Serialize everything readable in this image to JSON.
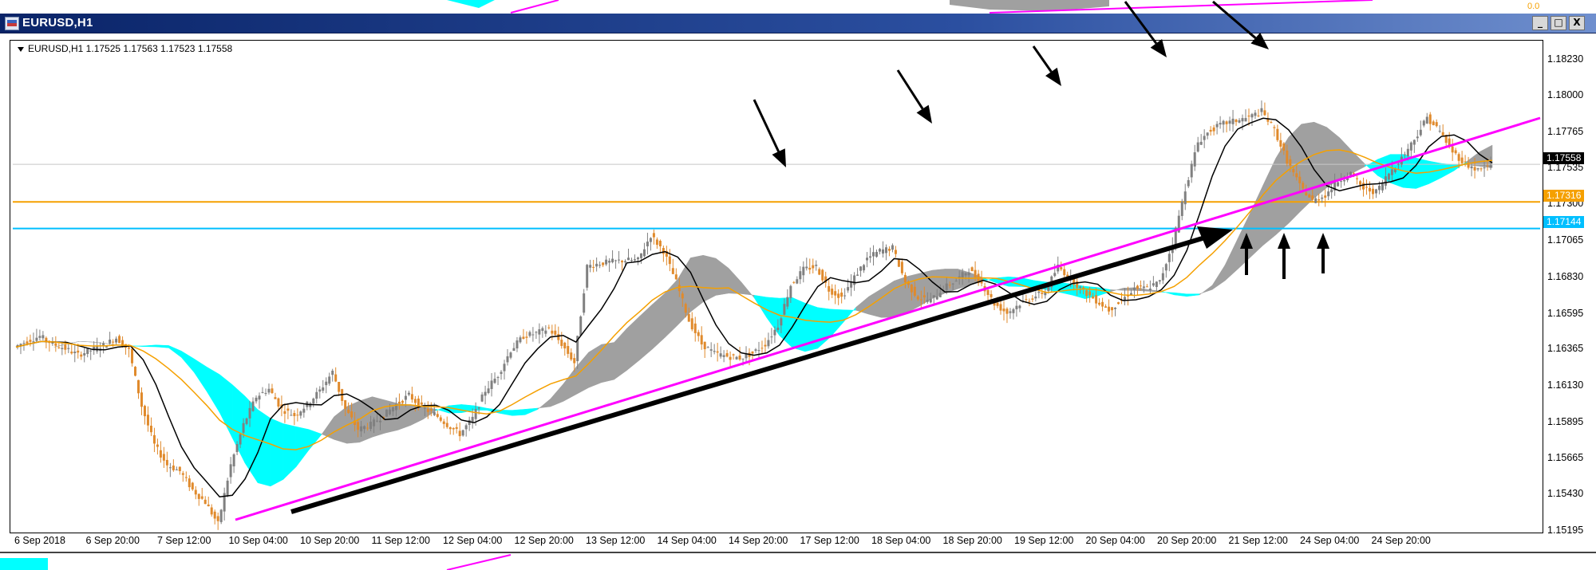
{
  "window": {
    "title": "EURUSD,H1",
    "buttons": [
      "_",
      "□",
      "X"
    ]
  },
  "chart_info": "EURUSD,H1  1.17525 1.17563 1.17523 1.17558",
  "price_labels": {
    "current": "1.17558",
    "orange_level": "1.17316",
    "cyan_level": "1.17144"
  },
  "colors": {
    "title_bar": "#0a2468",
    "bull_candle": "#808080",
    "bear_candle": "#e08a2c",
    "trendline": "#ff00ff",
    "orange_level": "#f5a000",
    "cyan_level": "#00bfff",
    "cloud_bull": "#a0a0a0",
    "cloud_bear": "#00ffff",
    "arrows": "#000000"
  },
  "top_strip_value": "0.0",
  "chart_data": {
    "type": "line",
    "title": "EURUSD,H1",
    "ohlc": {
      "open": 1.17525,
      "high": 1.17563,
      "low": 1.17523,
      "close": 1.17558
    },
    "ylim": [
      1.15195,
      1.18355
    ],
    "y_ticks": [
      "1.18230",
      "1.18000",
      "1.17765",
      "1.17535",
      "1.17300",
      "1.17065",
      "1.16830",
      "1.16595",
      "1.16365",
      "1.16130",
      "1.15895",
      "1.15665",
      "1.15430",
      "1.15195"
    ],
    "x_ticks": [
      "6 Sep 2018",
      "6 Sep 20:00",
      "7 Sep 12:00",
      "10 Sep 04:00",
      "10 Sep 20:00",
      "11 Sep 12:00",
      "12 Sep 04:00",
      "12 Sep 20:00",
      "13 Sep 12:00",
      "14 Sep 04:00",
      "14 Sep 20:00",
      "17 Sep 12:00",
      "18 Sep 04:00",
      "18 Sep 20:00",
      "19 Sep 12:00",
      "20 Sep 04:00",
      "20 Sep 20:00",
      "21 Sep 12:00",
      "24 Sep 04:00",
      "24 Sep 20:00"
    ],
    "horizontal_levels": [
      1.17316,
      1.17144,
      1.17558
    ],
    "price_path": [
      1.1638,
      1.1642,
      1.1645,
      1.164,
      1.1637,
      1.1633,
      1.1636,
      1.1639,
      1.1644,
      1.1636,
      1.16,
      1.1575,
      1.1562,
      1.1558,
      1.1546,
      1.1538,
      1.1524,
      1.1562,
      1.1588,
      1.1606,
      1.1611,
      1.1598,
      1.1594,
      1.1601,
      1.161,
      1.1622,
      1.1598,
      1.1585,
      1.1588,
      1.1594,
      1.1601,
      1.1607,
      1.1599,
      1.1595,
      1.1588,
      1.1582,
      1.1592,
      1.161,
      1.162,
      1.1636,
      1.1645,
      1.1647,
      1.165,
      1.164,
      1.1628,
      1.169,
      1.1692,
      1.1693,
      1.1694,
      1.1694,
      1.171,
      1.17,
      1.168,
      1.1655,
      1.164,
      1.1634,
      1.1632,
      1.1631,
      1.1634,
      1.164,
      1.1652,
      1.1678,
      1.1688,
      1.169,
      1.1675,
      1.167,
      1.1683,
      1.1695,
      1.17,
      1.1702,
      1.168,
      1.167,
      1.1668,
      1.1676,
      1.1681,
      1.1688,
      1.1679,
      1.1666,
      1.166,
      1.1666,
      1.167,
      1.1674,
      1.169,
      1.1682,
      1.1674,
      1.1668,
      1.1662,
      1.1668,
      1.1676,
      1.1676,
      1.168,
      1.1705,
      1.174,
      1.177,
      1.1778,
      1.1782,
      1.1784,
      1.1786,
      1.179,
      1.1778,
      1.1758,
      1.1742,
      1.1732,
      1.1736,
      1.1745,
      1.175,
      1.174,
      1.1738,
      1.175,
      1.176,
      1.1772,
      1.1786,
      1.1777,
      1.1764,
      1.1756,
      1.1752,
      1.1755
    ],
    "series": [
      {
        "name": "EURUSD,H1",
        "values": [
          1.1638,
          1.1642,
          1.1645,
          1.164,
          1.1637,
          1.1633,
          1.1636,
          1.1639,
          1.1644,
          1.1636,
          1.16,
          1.1575,
          1.1562,
          1.1558,
          1.1546,
          1.1538,
          1.1524,
          1.1562,
          1.1588,
          1.1606,
          1.1611,
          1.1598,
          1.1594,
          1.1601,
          1.161,
          1.1622,
          1.1598,
          1.1585,
          1.1588,
          1.1594,
          1.1601,
          1.1607,
          1.1599,
          1.1595,
          1.1588,
          1.1582,
          1.1592,
          1.161,
          1.162,
          1.1636,
          1.1645,
          1.1647,
          1.165,
          1.164,
          1.1628,
          1.169,
          1.1692,
          1.1693,
          1.1694,
          1.1694,
          1.171,
          1.17,
          1.168,
          1.1655,
          1.164,
          1.1634,
          1.1632,
          1.1631,
          1.1634,
          1.164,
          1.1652,
          1.1678,
          1.1688,
          1.169,
          1.1675,
          1.167,
          1.1683,
          1.1695,
          1.17,
          1.1702,
          1.168,
          1.167,
          1.1668,
          1.1676,
          1.1681,
          1.1688,
          1.1679,
          1.1666,
          1.166,
          1.1666,
          1.167,
          1.1674,
          1.169,
          1.1682,
          1.1674,
          1.1668,
          1.1662,
          1.1668,
          1.1676,
          1.1676,
          1.168,
          1.1705,
          1.174,
          1.177,
          1.1778,
          1.1782,
          1.1784,
          1.1786,
          1.179,
          1.1778,
          1.1758,
          1.1742,
          1.1732,
          1.1736,
          1.1745,
          1.175,
          1.174,
          1.1738,
          1.175,
          1.176,
          1.1772,
          1.1786,
          1.1777,
          1.1764,
          1.1756,
          1.1752,
          1.1755
        ]
      }
    ]
  }
}
